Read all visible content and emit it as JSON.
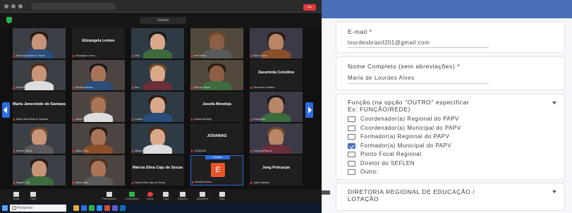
{
  "meeting": {
    "url": "",
    "view_label": "Galeria",
    "tiles": [
      {
        "type": "video",
        "label": "Maria Aparecida de Sousa"
      },
      {
        "type": "name",
        "name": "Elizangela Lemos",
        "label": "Elizangela Lemos"
      },
      {
        "type": "video",
        "label": "Vitor"
      },
      {
        "type": "video",
        "label": "Vera Maria"
      },
      {
        "type": "video",
        "label": "Maria Sousa"
      },
      {
        "type": "video",
        "label": "Francisca"
      },
      {
        "type": "video",
        "label": "Renata Mendes"
      },
      {
        "type": "video",
        "label": "Ana"
      },
      {
        "type": "video",
        "label": "Rita de Cássia"
      },
      {
        "type": "name",
        "name": "Zacarinda Colodino",
        "label": "Zacarinda Colodino"
      },
      {
        "type": "name",
        "name": "Maria Janecleide de Santana",
        "label": "Maria Janecleide de Santana"
      },
      {
        "type": "video",
        "label": "Maria Francisca"
      },
      {
        "type": "video",
        "label": "Lucélia"
      },
      {
        "type": "name",
        "name": "Josefa Mendeja",
        "label": "Josefa Mendeja"
      },
      {
        "type": "video",
        "label": "Rosangela"
      },
      {
        "type": "video",
        "label": "Helena Nunes"
      },
      {
        "type": "video",
        "label": "Gilson Silva"
      },
      {
        "type": "video",
        "label": "Waldemar"
      },
      {
        "type": "name",
        "name": "JOSANIAS",
        "label": "JOSANIAS"
      },
      {
        "type": "video",
        "label": "Francisca Barros"
      },
      {
        "type": "video",
        "label": "Raquel Lima"
      },
      {
        "type": "video",
        "label": "Maria Lúcia"
      },
      {
        "type": "name",
        "name": "Márcia Silva Caju de Souza",
        "label": "Márcia Silva Caju de Souza"
      },
      {
        "type": "avatar",
        "letter": "E",
        "speaker": "Enedina",
        "label": "Enedina Souza"
      },
      {
        "type": "name",
        "name": "Joeg Policarpo",
        "label": "Joeg Policarpo"
      }
    ],
    "toolbar": [
      {
        "icon": "mic-icon",
        "label": "Áudio"
      },
      {
        "icon": "video-icon",
        "label": "Vídeo"
      },
      {
        "icon": "participants-icon",
        "label": "Participantes"
      },
      {
        "icon": "share-icon",
        "label": "Compartilhar"
      },
      {
        "icon": "record-icon",
        "label": "Gravar"
      },
      {
        "icon": "chat-icon",
        "label": "Chat"
      },
      {
        "icon": "reactions-icon",
        "label": "Reações"
      },
      {
        "icon": "apps-icon",
        "label": "Aplicativos"
      },
      {
        "icon": "more-icon",
        "label": "Mais"
      }
    ],
    "end_label": "Sair",
    "taskbar": {
      "search_placeholder": "Pesquisar",
      "time": "",
      "date": ""
    }
  },
  "form": {
    "email_label": "E-mail *",
    "email_value": "lourdesbrasil201@gmail.com",
    "name_label": "Nome Completo (sem abreviações) *",
    "name_value": "Maria de Lourdes Alves",
    "funcao_label_1": "Função (na opção \"OUTRO\" especificar",
    "funcao_label_2": "Ex: FUNÇÃO/REDE)",
    "options": [
      {
        "label": "Coordenador(a) Regional do PAPV",
        "checked": false
      },
      {
        "label": "Coordenador(a) Municipal do PAPV",
        "checked": false
      },
      {
        "label": "Formador(a) Regional do PAPV",
        "checked": false
      },
      {
        "label": "Formador(a) Municipal do PAPV",
        "checked": true
      },
      {
        "label": "Ponto Focal Regional",
        "checked": false
      },
      {
        "label": "Diretor do SEFLEN",
        "checked": false
      },
      {
        "label": "Outro:",
        "checked": false
      }
    ],
    "diretoria_label_1": "DIRETORIA REGIONAL DE EDUCAÇÃO /",
    "diretoria_label_2": "LOTAÇÃO",
    "accent_color": "#4a6fb8"
  }
}
